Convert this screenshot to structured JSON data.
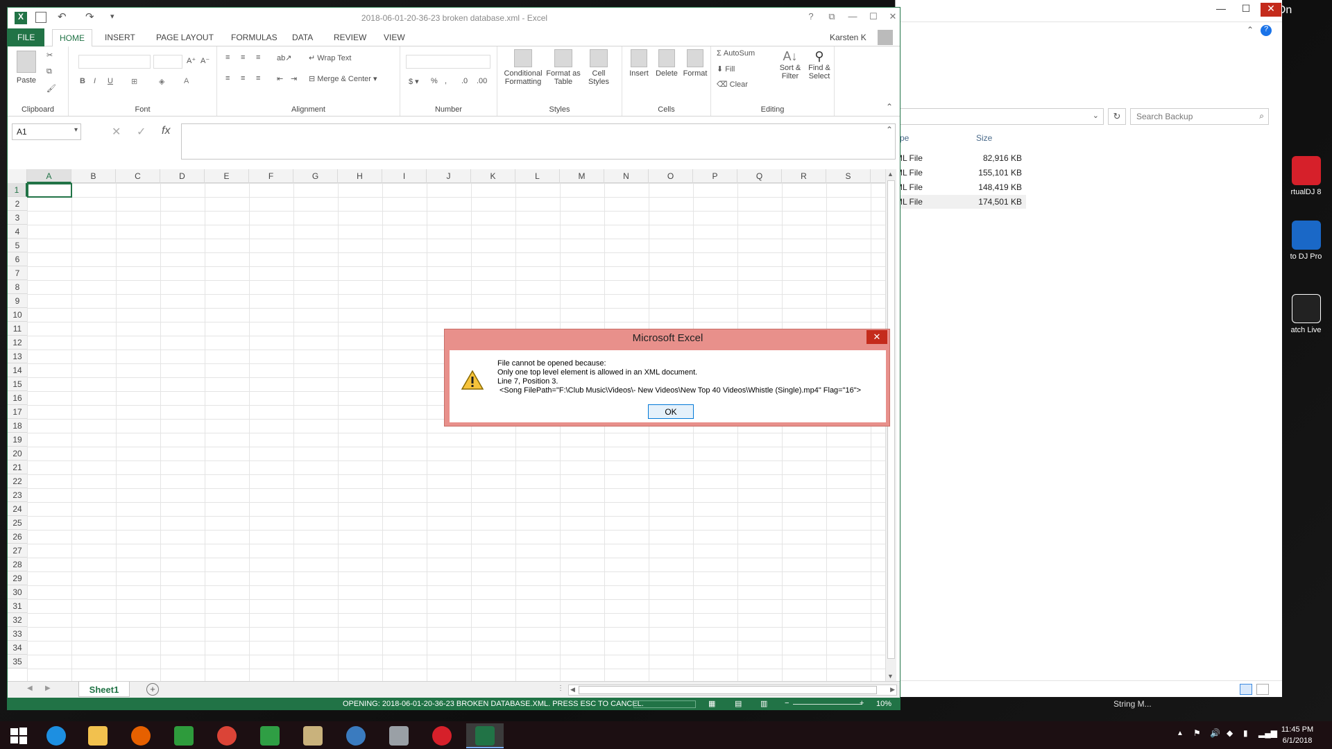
{
  "excel": {
    "title": "2018-06-01-20-36-23 broken database.xml - Excel",
    "user": "Karsten K",
    "tabs": [
      "FILE",
      "HOME",
      "INSERT",
      "PAGE LAYOUT",
      "FORMULAS",
      "DATA",
      "REVIEW",
      "VIEW"
    ],
    "ribbon": {
      "clipboard": {
        "label": "Clipboard",
        "paste": "Paste"
      },
      "font": {
        "label": "Font"
      },
      "alignment": {
        "label": "Alignment",
        "wrap_text": "Wrap Text",
        "merge_center": "Merge & Center"
      },
      "number": {
        "label": "Number"
      },
      "styles": {
        "label": "Styles",
        "conditional_1": "Conditional",
        "conditional_2": "Formatting",
        "format_table_1": "Format as",
        "format_table_2": "Table",
        "cell_styles_1": "Cell",
        "cell_styles_2": "Styles"
      },
      "cells": {
        "label": "Cells",
        "insert": "Insert",
        "delete": "Delete",
        "format": "Format"
      },
      "editing": {
        "label": "Editing",
        "autosum": "AutoSum",
        "fill": "Fill",
        "clear": "Clear",
        "sort_1": "Sort &",
        "sort_2": "Filter",
        "find_1": "Find &",
        "find_2": "Select"
      }
    },
    "name_box": "A1",
    "columns": [
      "A",
      "B",
      "C",
      "D",
      "E",
      "F",
      "G",
      "H",
      "I",
      "J",
      "K",
      "L",
      "M",
      "N",
      "O",
      "P",
      "Q",
      "R",
      "S"
    ],
    "rows": [
      "1",
      "2",
      "3",
      "4",
      "5",
      "6",
      "7",
      "8",
      "9",
      "10",
      "11",
      "12",
      "13",
      "14",
      "15",
      "16",
      "17",
      "18",
      "19",
      "20",
      "21",
      "22",
      "23",
      "24",
      "25",
      "26",
      "27",
      "28",
      "29",
      "30",
      "31",
      "32",
      "33",
      "34",
      "35"
    ],
    "sheet_tab": "Sheet1",
    "status_text": "OPENING: 2018-06-01-20-36-23 BROKEN DATABASE.XML. PRESS ESC TO CANCEL.",
    "zoom": "10%"
  },
  "dialog": {
    "title": "Microsoft Excel",
    "lines": [
      "File cannot be opened because:",
      "Only one top level element is allowed in an XML document.",
      "Line 7, Position 3.",
      "<Song FilePath=\"F:\\Club Music\\Videos\\- New Videos\\New Top 40 Videos\\Whistle (Single).mp4\" Flag=\"16\">"
    ],
    "ok": "OK"
  },
  "explorer": {
    "search_placeholder": "Search Backup",
    "col_type": "ype",
    "col_size": "Size",
    "files": [
      {
        "type": "ML File",
        "size": "82,916 KB"
      },
      {
        "type": "ML File",
        "size": "155,101 KB"
      },
      {
        "type": "ML File",
        "size": "148,419 KB"
      },
      {
        "type": "ML File",
        "size": "174,501 KB"
      }
    ],
    "title_fragment": "t On"
  },
  "desktop": {
    "icons": [
      "rtualDJ 8",
      "to DJ Pro",
      "atch Live"
    ],
    "bottom_text_1": "String M..."
  },
  "taskbar": {
    "time": "11:45 PM",
    "date": "6/1/2018"
  },
  "colors": {
    "excel_green": "#217346",
    "close_red": "#c42b1c"
  }
}
